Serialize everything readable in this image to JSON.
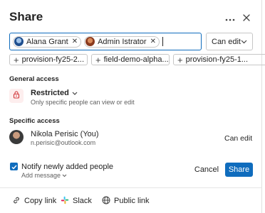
{
  "dialog": {
    "title": "Share"
  },
  "people_input": {
    "chips": [
      {
        "name": "Alana Grant",
        "avatar": "avatar-alana"
      },
      {
        "name": "Admin Istrator",
        "avatar": "avatar-admin"
      }
    ],
    "value": ""
  },
  "permission": {
    "selected": "Can edit"
  },
  "suggestions": [
    {
      "label": "provision-fy25-2..."
    },
    {
      "label": "field-demo-alpha..."
    },
    {
      "label": "provision-fy25-1..."
    }
  ],
  "general_access": {
    "label": "General access",
    "level": "Restricted",
    "description": "Only specific people can view or edit"
  },
  "specific_access": {
    "label": "Specific access",
    "people": [
      {
        "name": "Nikola Perisic (You)",
        "email": "n.perisic@outlook.com",
        "role": "Can edit"
      }
    ]
  },
  "notify": {
    "checked": true,
    "label": "Notify newly added people",
    "add_message": "Add message"
  },
  "actions": {
    "cancel": "Cancel",
    "share": "Share"
  },
  "footer": {
    "copy_link": "Copy link",
    "slack": "Slack",
    "public_link": "Public link"
  },
  "colors": {
    "accent": "#0f6cbd",
    "lock_tile_bg": "#fdeeee",
    "lock_icon": "#d13438"
  }
}
